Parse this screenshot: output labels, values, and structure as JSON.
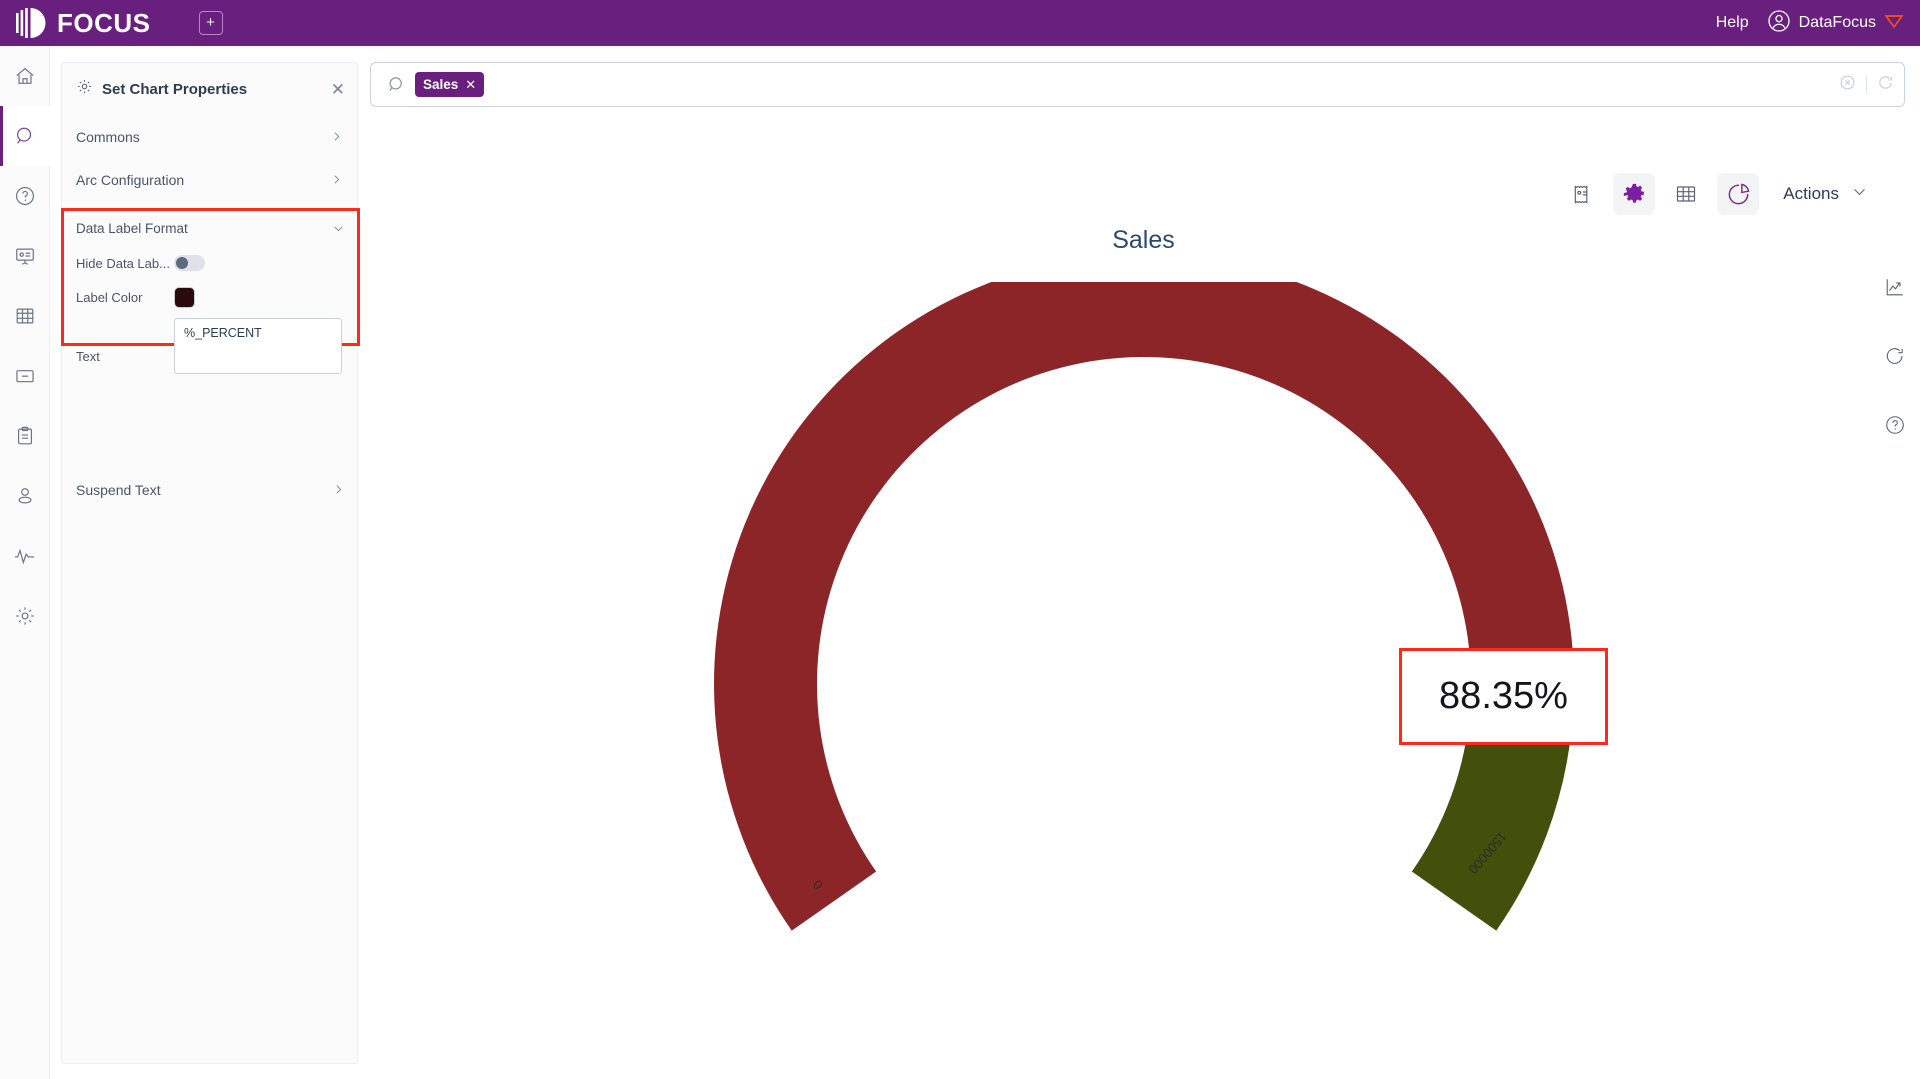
{
  "topbar": {
    "brand": "FOCUS",
    "logo_icon": "focus-logo-icon",
    "add_tab_icon": "add-tab-icon",
    "help_label": "Help",
    "user_name": "DataFocus",
    "user_avatar_icon": "user-circle-icon",
    "user_badge_icon": "diamond-badge-icon",
    "background_color": "#681f7e"
  },
  "rail": {
    "items": [
      {
        "name": "home-icon",
        "active": false
      },
      {
        "name": "search-icon",
        "active": true
      },
      {
        "name": "help-circle-icon",
        "active": false
      },
      {
        "name": "presentation-icon",
        "active": false
      },
      {
        "name": "table-grid-icon",
        "active": false
      },
      {
        "name": "folder-icon",
        "active": false
      },
      {
        "name": "clipboard-icon",
        "active": false
      },
      {
        "name": "user-icon",
        "active": false
      },
      {
        "name": "pulse-icon",
        "active": false
      },
      {
        "name": "settings-gear-icon",
        "active": false
      }
    ]
  },
  "panel": {
    "title": "Set Chart Properties",
    "gear_icon": "gear-icon",
    "close_icon": "close-icon",
    "sections": [
      {
        "label": "Commons",
        "expanded": false
      },
      {
        "label": "Arc Configuration",
        "expanded": false
      },
      {
        "label": "Data Label Format",
        "expanded": true
      },
      {
        "label": "Suspend Text",
        "expanded": false
      }
    ],
    "data_label_format": {
      "label": "Data Label Format",
      "hide_data_label": {
        "label": "Hide Data Lab...",
        "value": "off"
      },
      "label_color": {
        "label": "Label Color",
        "value": "#2a0a0a"
      },
      "text": {
        "label": "Text",
        "value": "%_PERCENT",
        "placeholder": ""
      },
      "highlight_color": "#fb2a19"
    },
    "suspend_text_label": "Suspend Text"
  },
  "search": {
    "search_icon": "search-icon",
    "placeholder": "",
    "chips": [
      {
        "label": "Sales",
        "remove_icon": "close-icon"
      }
    ],
    "clear_icon": "clear-circle-icon",
    "refresh_icon": "refresh-icon"
  },
  "chart_toolbar": {
    "buttons": [
      {
        "name": "receipt-icon",
        "active": false
      },
      {
        "name": "gear-icon",
        "active": true
      },
      {
        "name": "table-grid-icon",
        "active": false
      },
      {
        "name": "pie-chart-icon",
        "active": true
      }
    ],
    "actions_label": "Actions",
    "actions_chevron_icon": "chevron-down-icon"
  },
  "side_tools": [
    {
      "name": "trend-chart-icon"
    },
    {
      "name": "reset-refresh-icon"
    },
    {
      "name": "help-circle-icon"
    }
  ],
  "chart_data": {
    "type": "pie",
    "variant": "gauge-donut",
    "title": "Sales",
    "center_label": "88.35%",
    "center_label_highlighted": true,
    "highlight_color": "#fb2a19",
    "min": 0,
    "max": 1500000,
    "value_percent": 88.35,
    "axis_tick_labels": [
      "0",
      "1500000"
    ],
    "start_angle_deg": 215,
    "end_angle_deg": -35,
    "segments": [
      {
        "name": "value",
        "percent": 88.35,
        "color": "#8b2528"
      },
      {
        "name": "remainder",
        "percent": 11.65,
        "color": "#43500b"
      }
    ],
    "legend": "none",
    "grid": false,
    "xlabel": "",
    "ylabel": ""
  }
}
